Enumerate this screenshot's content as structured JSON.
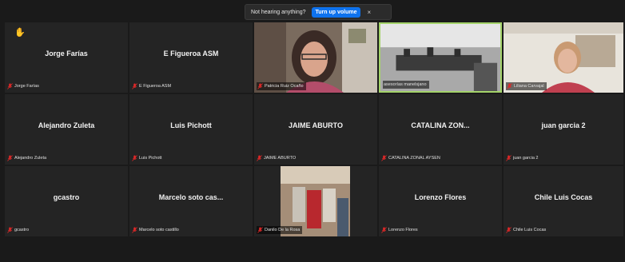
{
  "banner": {
    "message": "Not hearing anything?",
    "button_label": "Turn up volume",
    "close_glyph": "×"
  },
  "colors": {
    "active_speaker_border": "#a4d36a",
    "banner_button": "#0e72ed",
    "mic_muted": "#e02828",
    "raise_hand": "#f5b400"
  },
  "tiles": [
    {
      "display": "Jorge Farías",
      "label": "Jorge Farías",
      "raised_hand": true
    },
    {
      "display": "E Figueroa ASM",
      "label": "E Figueroa ASM"
    },
    {
      "video": true,
      "label": "Patricia Ruiz Ocaño"
    },
    {
      "video": true,
      "label": "asesorías manelsjano",
      "active_speaker": true
    },
    {
      "video": true,
      "label": "Liliana Carvajal"
    },
    {
      "display": "Alejandro Zuleta",
      "label": "Alejandro Zuleta"
    },
    {
      "display": "Luis Pichott",
      "label": "Luis Pichott"
    },
    {
      "display": "JAIME ABURTO",
      "label": "JAIME ABURTO"
    },
    {
      "display": "CATALINA  ZON...",
      "label": "CATALINA ZONAL AYSEN"
    },
    {
      "display": "juan garcia 2",
      "label": "juan garcia 2"
    },
    {
      "display": "gcastro",
      "label": "gcastro"
    },
    {
      "display": "Marcelo soto cas...",
      "label": "Marcelo soto castillo"
    },
    {
      "video": true,
      "label": "Danilo De la Rosa"
    },
    {
      "display": "Lorenzo Flores",
      "label": "Lorenzo Flores"
    },
    {
      "display": "Chile Luis Cocas",
      "label": "Chile Luis Cocas"
    }
  ]
}
